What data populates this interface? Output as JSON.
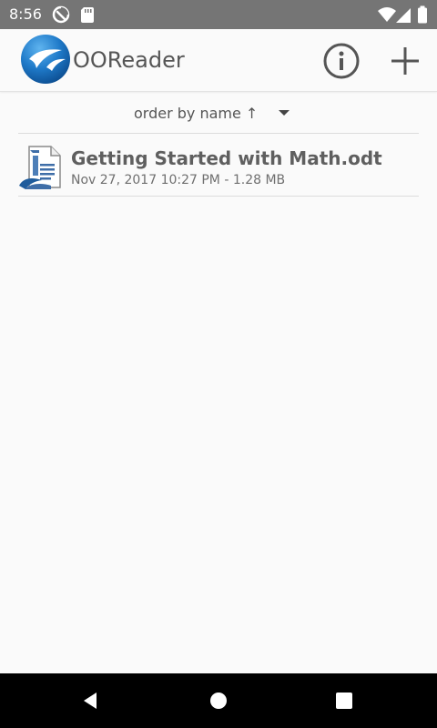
{
  "status_bar": {
    "time": "8:56",
    "icons": [
      "sync-icon",
      "sd-card-icon",
      "wifi-icon",
      "cell-signal-icon",
      "battery-icon"
    ]
  },
  "app_bar": {
    "title": "OOReader",
    "logo_icon": "ooreader-logo-icon",
    "actions": [
      "info-icon",
      "add-icon"
    ]
  },
  "sort": {
    "label": "order by name ↑",
    "caret_icon": "caret-down-icon"
  },
  "files": [
    {
      "name": "Getting Started with Math.odt",
      "meta": "Nov 27, 2017 10:27 PM - 1.28 MB",
      "icon": "odt-document-icon"
    }
  ],
  "navigation": {
    "icons": [
      "back-icon",
      "home-icon",
      "recents-icon"
    ]
  },
  "colors": {
    "status_bar_background": "#757575",
    "app_background": "#fafafa",
    "text_primary": "#555555",
    "logo_blue": "#1f7ac9",
    "navigation_background": "#000000"
  }
}
